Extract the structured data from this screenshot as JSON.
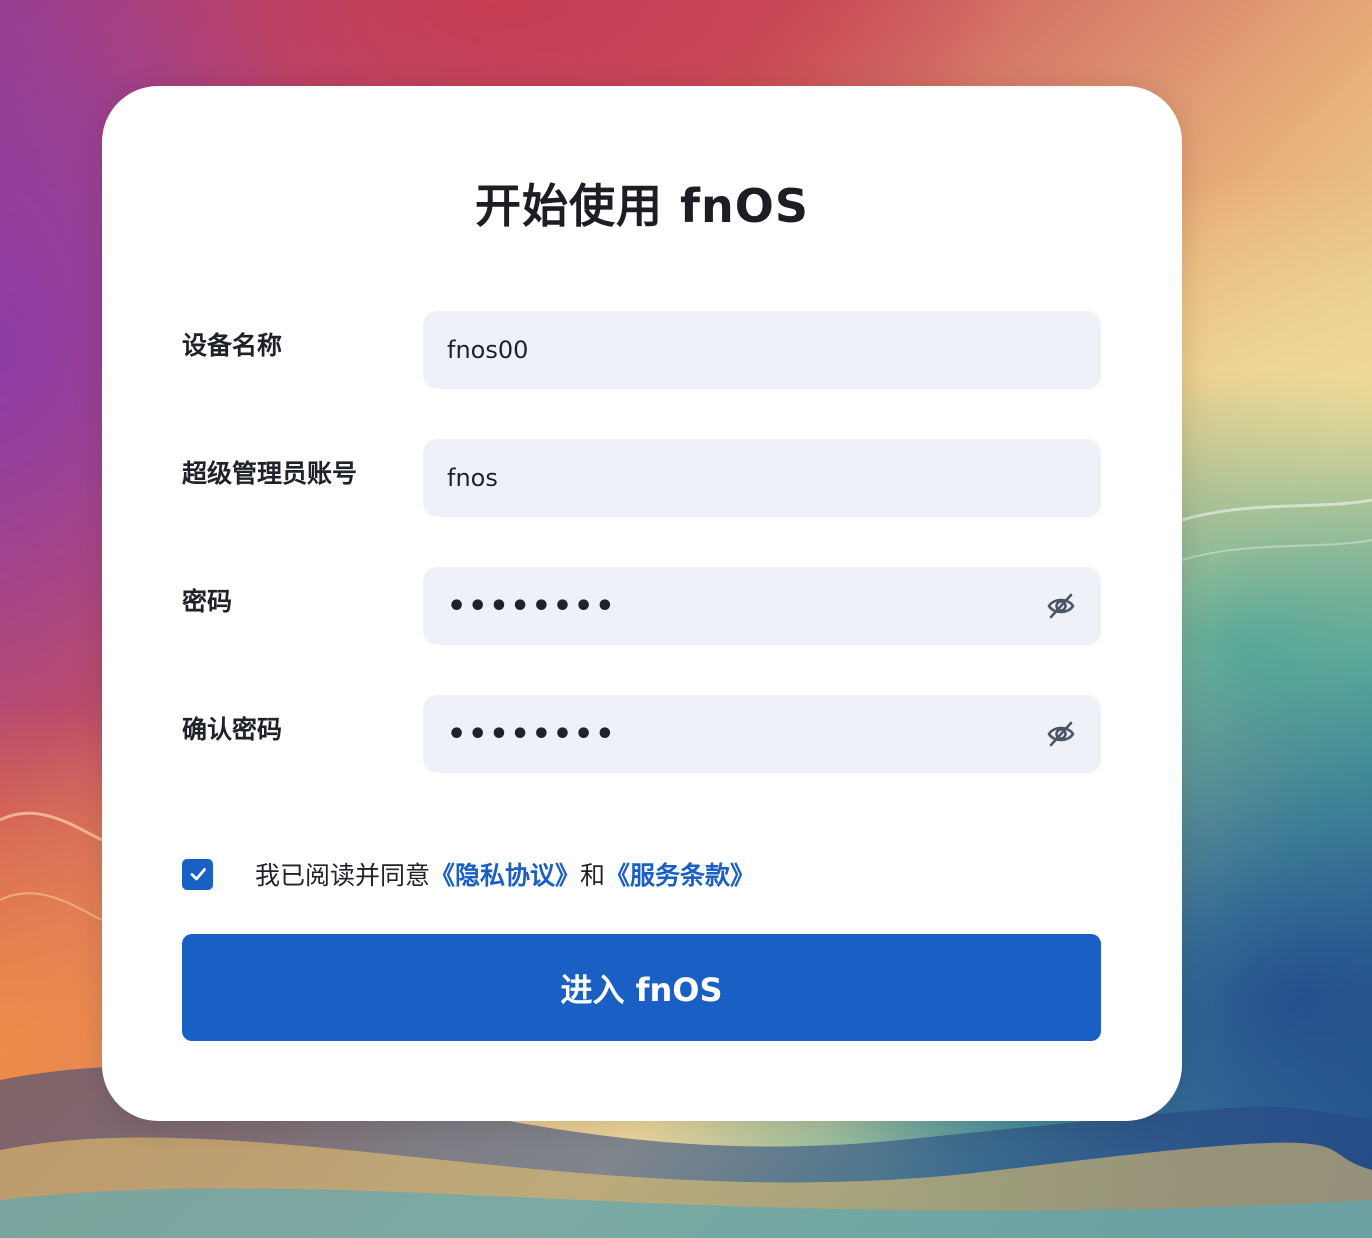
{
  "page": {
    "title": "开始使用 fnOS"
  },
  "form": {
    "device_name": {
      "label": "设备名称",
      "value": "fnos00"
    },
    "admin_account": {
      "label": "超级管理员账号",
      "value": "fnos"
    },
    "password": {
      "label": "密码",
      "masked_value": "••••••••",
      "toggle_icon": "eye-off-icon"
    },
    "confirm_password": {
      "label": "确认密码",
      "masked_value": "••••••••",
      "toggle_icon": "eye-off-icon"
    }
  },
  "agreement": {
    "checked": true,
    "prefix": "我已阅读并同意",
    "privacy_link": "《隐私协议》",
    "conjunction": "和",
    "terms_link": "《服务条款》"
  },
  "submit": {
    "label": "进入 fnOS"
  },
  "colors": {
    "accent": "#1a5fc4",
    "field_bg": "#eef2f8",
    "card_bg": "#ffffff",
    "text": "#1f2229"
  }
}
